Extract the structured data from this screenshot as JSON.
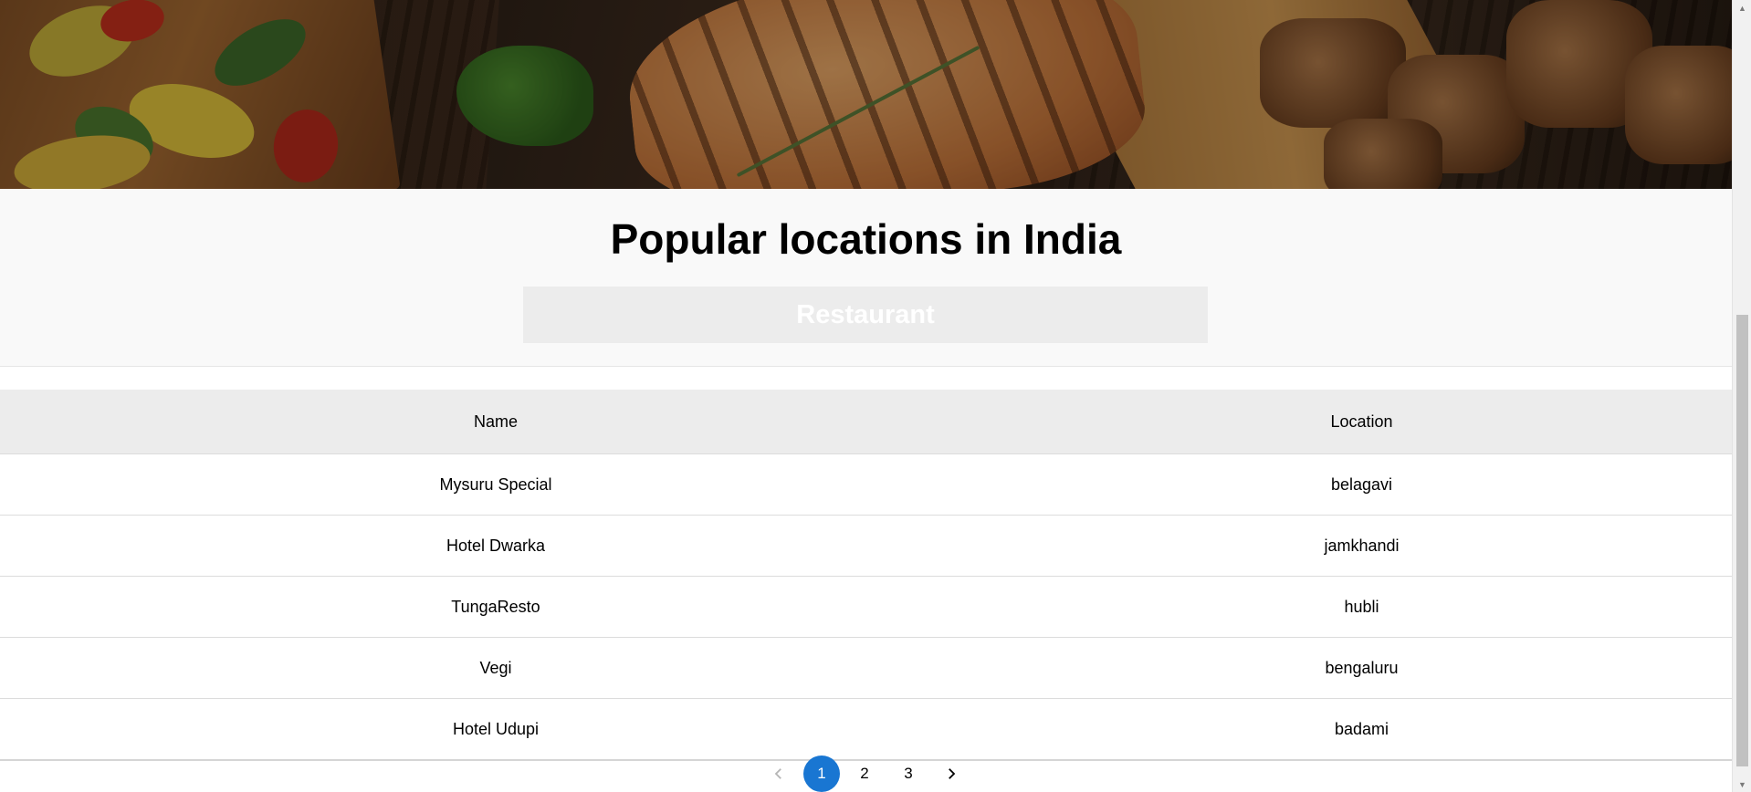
{
  "hero": {
    "image_icon": "food-platter-image"
  },
  "page": {
    "title": "Popular locations in India",
    "category": "Restaurant"
  },
  "table": {
    "columns": [
      "Name",
      "Location"
    ],
    "rows": [
      {
        "name": "Mysuru Special",
        "location": "belagavi"
      },
      {
        "name": "Hotel Dwarka",
        "location": "jamkhandi"
      },
      {
        "name": "TungaResto",
        "location": "hubli"
      },
      {
        "name": "Vegi",
        "location": "bengaluru"
      },
      {
        "name": "Hotel Udupi",
        "location": "badami"
      }
    ]
  },
  "pagination": {
    "pages": [
      "1",
      "2",
      "3"
    ],
    "current": "1",
    "prev_icon": "chevron-left-icon",
    "next_icon": "chevron-right-icon"
  },
  "colors": {
    "accent": "#1976d2",
    "header_bg": "#ececec",
    "section_bg": "#f9f9f9"
  }
}
